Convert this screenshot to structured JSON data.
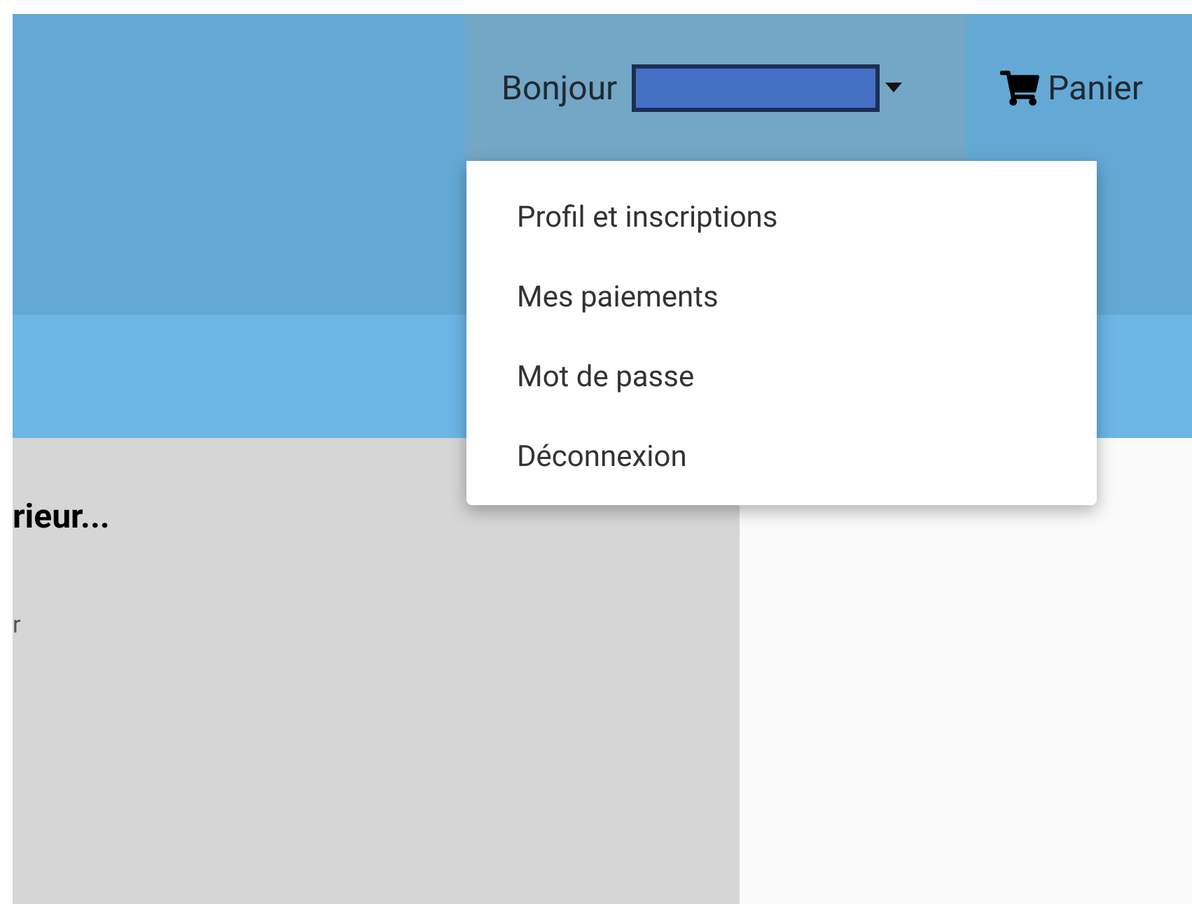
{
  "header": {
    "user_menu": {
      "greeting": "Bonjour",
      "expanded": true
    },
    "cart": {
      "label": "Panier"
    }
  },
  "dropdown": {
    "items": [
      {
        "label": "Profil et inscriptions"
      },
      {
        "label": "Mes paiements"
      },
      {
        "label": "Mot de passe"
      },
      {
        "label": "Déconnexion"
      }
    ]
  },
  "content": {
    "heading": "rieur...",
    "text": "r"
  }
}
